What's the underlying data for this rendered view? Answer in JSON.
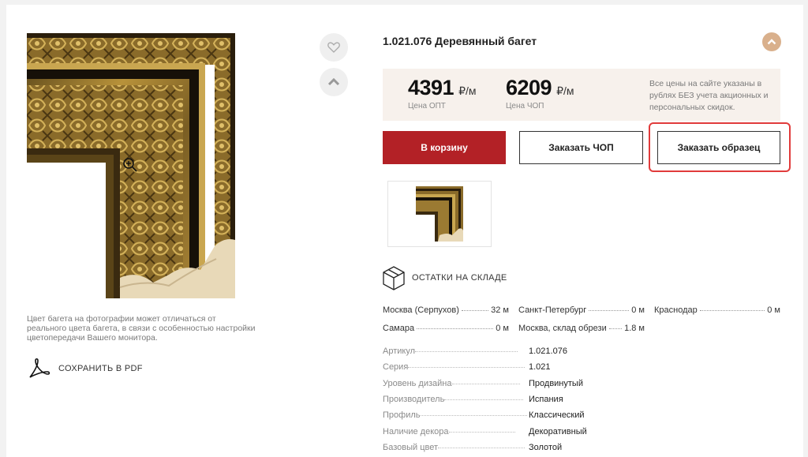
{
  "product": {
    "title": "1.021.076 Деревянный багет"
  },
  "photo_note": "Цвет багета на фотографии может отличаться от реального цвета багета, в связи с особенностью настройки цветопередачи Вашего монитора.",
  "pdf_label": "СОХРАНИТЬ В PDF",
  "prices": {
    "wholesale": {
      "value": "4391",
      "unit": "₽/м",
      "label": "Цена ОПТ"
    },
    "retail": {
      "value": "6209",
      "unit": "₽/м",
      "label": "Цена ЧОП"
    },
    "note": "Все цены на сайте указаны в рублях БЕЗ учета акционных и персональных скидок."
  },
  "buttons": {
    "cart": "В корзину",
    "order_chop": "Заказать ЧОП",
    "order_sample": "Заказать образец"
  },
  "stock": {
    "heading": "ОСТАТКИ НА СКЛАДЕ",
    "items": [
      {
        "city": "Москва (Серпухов)",
        "qty": "32 м"
      },
      {
        "city": "Санкт-Петербург",
        "qty": "0 м"
      },
      {
        "city": "Краснодар",
        "qty": "0 м"
      },
      {
        "city": "Самара",
        "qty": "0 м"
      },
      {
        "city": "Москва, склад обрези",
        "qty": "1.8 м"
      }
    ]
  },
  "specs": [
    {
      "key": "Артикул",
      "value": "1.021.076"
    },
    {
      "key": "Серия",
      "value": "1.021"
    },
    {
      "key": "Уровень дизайна",
      "value": "Продвинутый"
    },
    {
      "key": "Производитель",
      "value": "Испания"
    },
    {
      "key": "Профиль",
      "value": "Классический"
    },
    {
      "key": "Наличие декора",
      "value": "Декоративный"
    },
    {
      "key": "Базовый цвет",
      "value": "Золотой"
    }
  ],
  "icons": {
    "favorite": "heart-icon",
    "up": "chevron-up-icon",
    "zoom": "zoom-in-icon",
    "pdf": "acrobat-icon",
    "stock": "box-icon"
  },
  "colors": {
    "accent_red": "#b32126",
    "collapse_tan": "#d9b08c",
    "price_bg": "#f7f1ec",
    "highlight": "#e13b3b"
  }
}
